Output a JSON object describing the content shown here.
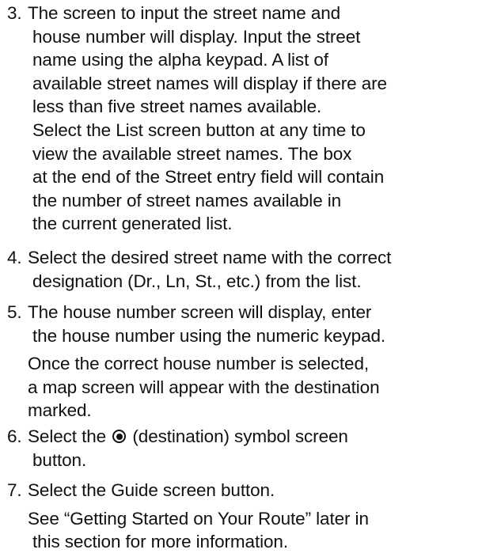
{
  "steps": [
    {
      "number": "3.",
      "lines": [
        "The screen to input the street name and",
        "house number will display. Input the street",
        "name using the alpha keypad. A list of",
        "available street names will display if there are",
        "less than five street names available.",
        "Select the List screen button at any time to",
        "view the available street names. The box",
        "at the end of the Street entry field will contain",
        "the number of street names available in",
        "the current generated list."
      ]
    },
    {
      "number": "4.",
      "lines": [
        "Select the desired street name with the correct",
        "designation (Dr., Ln, St., etc.) from the list."
      ]
    },
    {
      "number": "5.",
      "lines": [
        "The house number screen will display, enter",
        "the house number using the numeric keypad."
      ],
      "sub_lines": [
        "Once the correct house number is selected,",
        "a map screen will appear with the destination",
        "marked."
      ]
    },
    {
      "number": "6.",
      "line1_before": "Select the",
      "line1_after": "(destination) symbol screen",
      "icon": "destination-target-icon",
      "lines": [
        "button."
      ]
    },
    {
      "number": "7.",
      "lines": [
        "Select the Guide screen button."
      ],
      "sub_lines": [
        "See “Getting Started on Your Route” later in",
        "this section for more information."
      ]
    }
  ]
}
